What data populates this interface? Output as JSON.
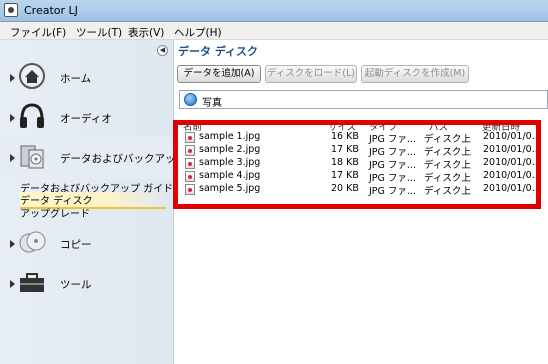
{
  "window": {
    "title": "Creator LJ"
  },
  "menu": [
    "ファイル(F)",
    "ツール(T)",
    "表示(V)",
    "ヘルプ(H)"
  ],
  "sidebar": {
    "categories": [
      {
        "label": "ホーム",
        "icon": "home-icon"
      },
      {
        "label": "オーディオ",
        "icon": "headphones-icon"
      },
      {
        "label": "データおよびバックアップ",
        "icon": "data-backup-icon"
      },
      {
        "label": "コピー",
        "icon": "copy-icon"
      },
      {
        "label": "ツール",
        "icon": "toolbox-icon"
      }
    ],
    "sub_items": [
      "データおよびバックアップ ガイド",
      "データ ディスク",
      "アップグレード"
    ],
    "selected_sub_item": "データ ディスク"
  },
  "main": {
    "title": "データ ディスク",
    "toolbar": {
      "add_label": "データを追加(A)",
      "load_label": "ディスクをロード(L)",
      "boot_label": "起動ディスクを作成(M)"
    },
    "path": "写真",
    "columns": [
      "名前",
      "サイズ",
      "タイプ",
      "パス",
      "更新日時"
    ],
    "files": [
      {
        "name": "sample 1.jpg",
        "size": "16 KB",
        "type": "JPG ファ...",
        "path": "ディスク上",
        "modified": "2010/01/0..."
      },
      {
        "name": "sample 2.jpg",
        "size": "17 KB",
        "type": "JPG ファ...",
        "path": "ディスク上",
        "modified": "2010/01/0..."
      },
      {
        "name": "sample 3.jpg",
        "size": "18 KB",
        "type": "JPG ファ...",
        "path": "ディスク上",
        "modified": "2010/01/0..."
      },
      {
        "name": "sample 4.jpg",
        "size": "17 KB",
        "type": "JPG ファ...",
        "path": "ディスク上",
        "modified": "2010/01/0..."
      },
      {
        "name": "sample 5.jpg",
        "size": "20 KB",
        "type": "JPG ファ...",
        "path": "ディスク上",
        "modified": "2010/01/0..."
      }
    ]
  },
  "colors": {
    "highlight": "#e00000",
    "title_blue": "#1b4f8a",
    "selection": "#f0c040"
  }
}
